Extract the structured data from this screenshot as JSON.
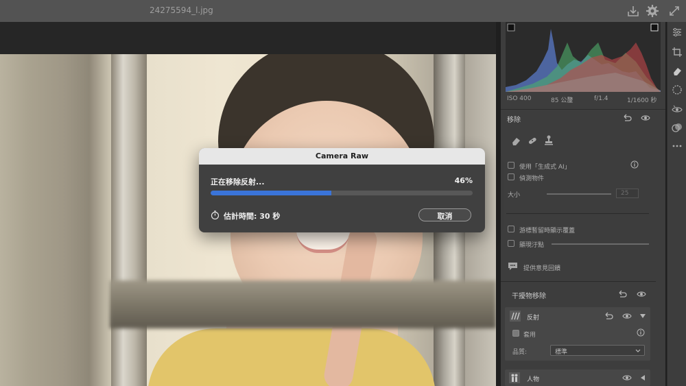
{
  "titlebar": {
    "filename": "24275594_l.jpg"
  },
  "histogram": {
    "iso": "ISO 400",
    "focal": "85 公釐",
    "aperture": "f/1.4",
    "shutter": "1/1600 秒"
  },
  "remove": {
    "title": "移除",
    "use_generative_ai": "使用「生成式 AI」",
    "detect_objects": "偵測物件",
    "size_label": "大小",
    "size_value": "25",
    "show_overlay_on_hover": "游標暫留時顯示覆蓋",
    "visualize_spots": "顯現汙點",
    "feedback": "提供意見回饋"
  },
  "distraction": {
    "title": "干擾物移除",
    "reflections": "反射",
    "apply": "套用",
    "quality_label": "品質:",
    "quality_value": "標準",
    "people": "人物"
  },
  "modal": {
    "title": "Camera Raw",
    "status": "正在移除反射...",
    "percent_text": "46%",
    "progress": 0.46,
    "eta": "估計時間: 30 秒",
    "cancel": "取消"
  },
  "colors": {
    "accent": "#3a74d9",
    "panel": "#3d3d3d",
    "titlebar": "#535353"
  }
}
